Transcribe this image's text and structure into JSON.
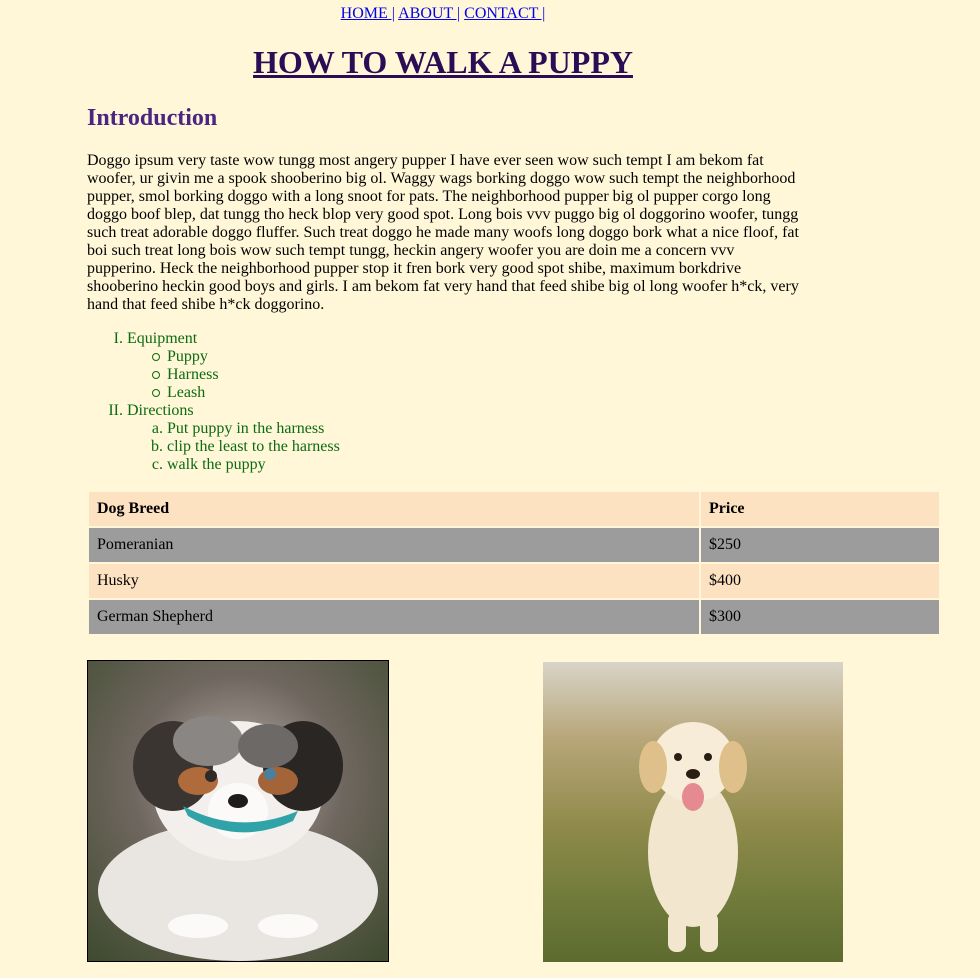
{
  "nav": {
    "home": "HOME |",
    "about": "ABOUT |",
    "contact": "CONTACT |"
  },
  "page_title": "HOW TO WALK A PUPPY",
  "intro": {
    "heading": "Introduction",
    "paragraph": "Doggo ipsum very taste wow tungg most angery pupper I have ever seen wow such tempt I am bekom fat woofer, ur givin me a spook shooberino big ol. Waggy wags borking doggo wow such tempt the neighborhood pupper, smol borking doggo with a long snoot for pats. The neighborhood pupper big ol pupper corgo long doggo boof blep, dat tungg tho heck blop very good spot. Long bois vvv puggo big ol doggorino woofer, tungg such treat adorable doggo fluffer. Such treat doggo he made many woofs long doggo bork what a nice floof, fat boi such treat long bois wow such tempt tungg, heckin angery woofer you are doin me a concern vvv pupperino. Heck the neighborhood pupper stop it fren bork very good spot shibe, maximum borkdrive shooberino heckin good boys and girls. I am bekom fat very hand that feed shibe big ol long woofer h*ck, very hand that feed shibe h*ck doggorino."
  },
  "outline": {
    "sections": [
      {
        "marker": "I.",
        "label": "Equipment",
        "items": [
          "Puppy",
          "Harness",
          "Leash"
        ]
      },
      {
        "marker": "II.",
        "label": "Directions",
        "items": [
          {
            "marker": "a.",
            "label": "Put puppy in the harness"
          },
          {
            "marker": "b.",
            "label": "clip the least to the harness"
          },
          {
            "marker": "c.",
            "label": "walk the puppy"
          }
        ]
      }
    ]
  },
  "table": {
    "headers": [
      "Dog Breed",
      "Price"
    ],
    "rows": [
      [
        "Pomeranian",
        "$250"
      ],
      [
        "Husky",
        "$400"
      ],
      [
        "German Shepherd",
        "$300"
      ]
    ]
  },
  "colors": {
    "background": "#fff7d7",
    "heading": "#4b2582",
    "list_text": "#0b6b12",
    "row_light": "#fde2c2",
    "row_dark": "#9c9c9c"
  }
}
